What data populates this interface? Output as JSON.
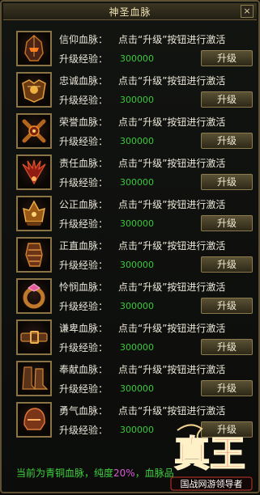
{
  "window": {
    "title": "神圣血脉",
    "close_glyph": "×"
  },
  "bloodlines": [
    {
      "name": "信仰血脉：",
      "hint": "点击“升级”按钮进行激活",
      "exp_label": "升级经验：",
      "exp": "300000",
      "button": "升级",
      "icon": "dark-helmet-icon"
    },
    {
      "name": "忠诚血脉：",
      "hint": "点击“升级”按钮进行激活",
      "exp_label": "升级经验：",
      "exp": "300000",
      "button": "升级",
      "icon": "golden-armor-icon"
    },
    {
      "name": "荣誉血脉：",
      "hint": "点击“升级”按钮进行激活",
      "exp_label": "升级经验：",
      "exp": "300000",
      "button": "升级",
      "icon": "cross-weapon-icon"
    },
    {
      "name": "责任血脉：",
      "hint": "点击“升级”按钮进行激活",
      "exp_label": "升级经验：",
      "exp": "300000",
      "button": "升级",
      "icon": "red-wings-icon"
    },
    {
      "name": "公正血脉：",
      "hint": "点击“升级”按钮进行激活",
      "exp_label": "升级经验：",
      "exp": "300000",
      "button": "升级",
      "icon": "golden-crown-icon"
    },
    {
      "name": "正直血脉：",
      "hint": "点击“升级”按钮进行激活",
      "exp_label": "升级经验：",
      "exp": "300000",
      "button": "升级",
      "icon": "gauntlet-icon"
    },
    {
      "name": "怜悯血脉：",
      "hint": "点击“升级”按钮进行激活",
      "exp_label": "升级经验：",
      "exp": "300000",
      "button": "升级",
      "icon": "ring-icon"
    },
    {
      "name": "谦卑血脉：",
      "hint": "点击“升级”按钮进行激活",
      "exp_label": "升级经验：",
      "exp": "300000",
      "button": "升级",
      "icon": "belt-icon"
    },
    {
      "name": "奉献血脉：",
      "hint": "点击“升级”按钮进行激活",
      "exp_label": "升级经验：",
      "exp": "300000",
      "button": "升级",
      "icon": "boots-icon"
    },
    {
      "name": "勇气血脉：",
      "hint": "点击“升级”按钮进行激活",
      "exp_label": "升级经验：",
      "exp": "300000",
      "button": "升级",
      "icon": "helm-icon"
    }
  ],
  "footer": {
    "prefix": "当前为青铜血脉，纯度",
    "percent": "20%",
    "suffix": "，血脉品"
  },
  "watermark": {
    "logo": "真王",
    "slogan": "国战网游领导者"
  },
  "colors": {
    "exp_green": "#3ac83a",
    "percent_magenta": "#d65ad6",
    "frame_gold": "#8a7446",
    "logo_red": "#d8231b"
  }
}
